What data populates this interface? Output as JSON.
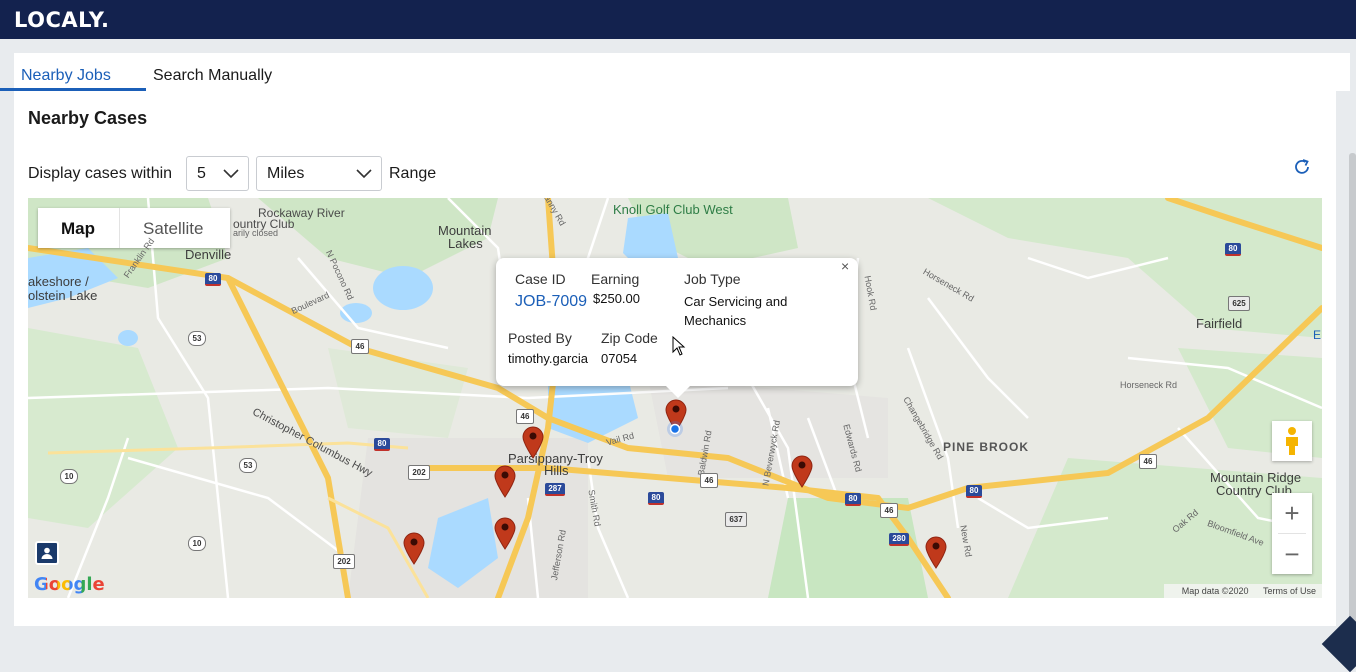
{
  "app": {
    "brand": "LOCALY."
  },
  "tabs": [
    {
      "label": "Nearby Jobs",
      "active": true
    },
    {
      "label": "Search Manually",
      "active": false
    }
  ],
  "section": {
    "title": "Nearby Cases"
  },
  "filter": {
    "label": "Display cases within",
    "distance_value": "5",
    "unit_value": "Miles",
    "suffix": "Range"
  },
  "map": {
    "type_options": {
      "map": "Map",
      "satellite": "Satellite"
    },
    "labels": {
      "denville": "Denville",
      "rockaway": "Rockaway River",
      "country_club": "ountry Club",
      "temp_closed": "arily closed",
      "mountain_lakes_1": "Mountain",
      "mountain_lakes_2": "Lakes",
      "knoll": "Knoll Golf Club West",
      "lakeshore_1": "akeshore /",
      "lakeshore_2": "olstein Lake",
      "fairfield": "Fairfield",
      "parsippany_1": "Parsippany-Troy",
      "parsippany_2": "Hills",
      "pine_brook": "PINE BROOK",
      "mountain_ridge_1": "Mountain Ridge",
      "mountain_ridge_2": "Country Club",
      "columbus_hwy": "Christopher Columbus Hwy",
      "vail_rd": "Vail Rd",
      "baldwin_rd": "Baldwin Rd",
      "n_beverwyck": "N Beverwyck Rd",
      "edwards_rd": "Edwards Rd",
      "horseneck_rd": "Horseneck Rd",
      "horseneck_rd_2": "Horseneck Rd",
      "changebridge": "Changebridge Rd",
      "bloomfield": "Bloomfield Ave",
      "oak_rd": "Oak Rd",
      "smith_rd": "Smith Rd",
      "jefferson_rd": "Jefferson Rd",
      "new_rd": "New Rd",
      "boulevard": "Boulevard",
      "n_pocono": "N Pocono Rd",
      "franklin": "Franklin Rd",
      "fanny_rd": "Fanny Rd",
      "hook_rd": "Hook Rd",
      "e_label": "E"
    },
    "shields": {
      "i80_a": "80",
      "i80_b": "80",
      "i80_c": "80",
      "i80_d": "80",
      "i80_e": "80",
      "i80_f": "80",
      "i287": "287",
      "i280": "280",
      "us46_a": "46",
      "us46_b": "46",
      "us46_c": "46",
      "us46_d": "46",
      "us46_e": "46",
      "us46_f": "46",
      "us202_a": "202",
      "us202_b": "202",
      "r53_a": "53",
      "r53_b": "53",
      "r10_a": "10",
      "r10_b": "10",
      "r625": "625",
      "r637": "637"
    },
    "popup": {
      "case_id_label": "Case ID",
      "case_id": "JOB-7009",
      "earning_label": "Earning",
      "earning": "$250.00",
      "job_type_label": "Job Type",
      "job_type_line1": "Car Servicing and",
      "job_type_line2": "Mechanics",
      "posted_by_label": "Posted By",
      "posted_by": "timothy.garcia",
      "zip_label": "Zip Code",
      "zip": "07054",
      "close": "×"
    },
    "zoom_in": "+",
    "zoom_out": "−",
    "google": "Google",
    "map_data": "Map data ©2020",
    "terms": "Terms of Use",
    "colors": {
      "pin": "#c0391b",
      "road_major": "#f6c856",
      "water": "#aadaff",
      "park": "#c8e6c1"
    }
  }
}
